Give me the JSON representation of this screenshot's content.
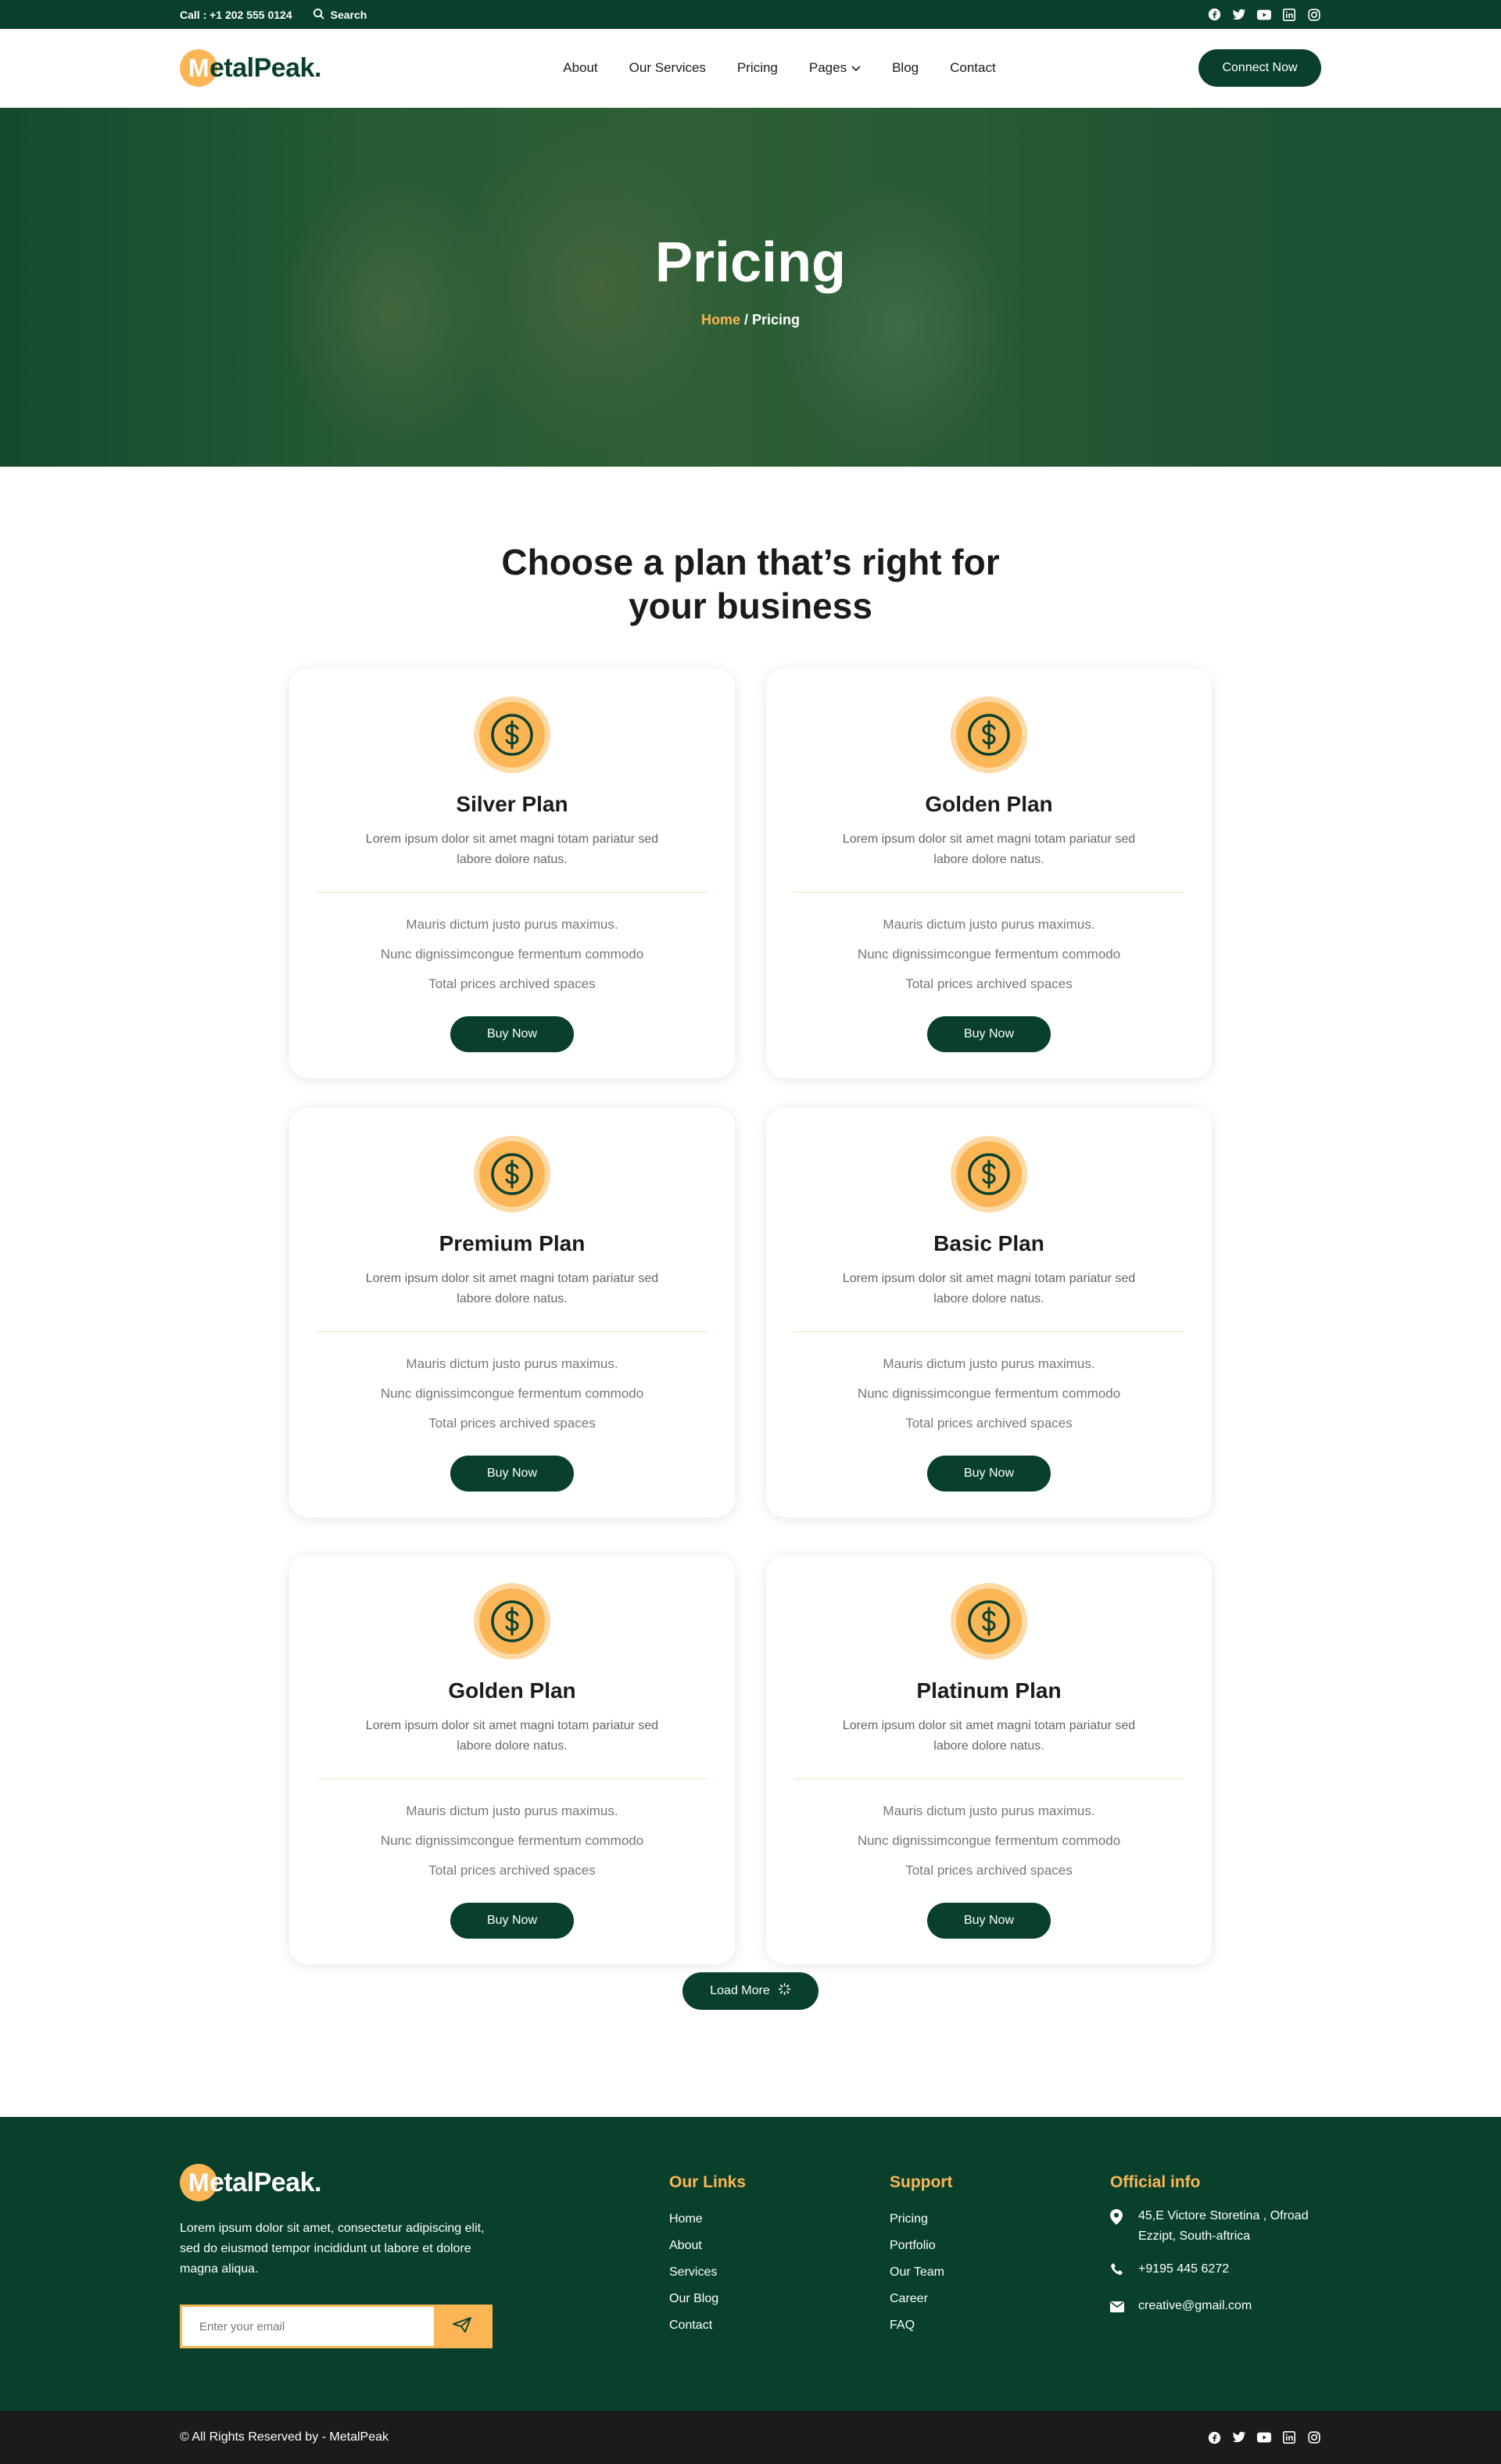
{
  "topbar": {
    "call": "Call : +1 202 555 0124",
    "search_label": "Search",
    "social": [
      "facebook-icon",
      "twitter-icon",
      "youtube-icon",
      "linkedin-icon",
      "instagram-icon"
    ]
  },
  "header": {
    "logo_initial": "M",
    "logo_rest": "etalPeak.",
    "nav": [
      {
        "label": "About"
      },
      {
        "label": "Our Services"
      },
      {
        "label": "Pricing"
      },
      {
        "label": "Pages"
      },
      {
        "label": "Blog"
      },
      {
        "label": "Contact"
      }
    ],
    "cta": "Connect Now"
  },
  "hero": {
    "title": "Pricing",
    "breadcrumb_home": "Home",
    "breadcrumb_sep": " / ",
    "breadcrumb_current": "Pricing"
  },
  "pricing": {
    "title": "Choose a plan that’s right for your business",
    "plans": [
      {
        "name": "Silver Plan",
        "desc": "Lorem ipsum dolor sit amet magni totam pariatur sed labore dolore natus.",
        "features": [
          "Mauris dictum justo purus maximus.",
          "Nunc dignissimcongue fermentum commodo",
          "Total prices archived spaces"
        ],
        "button": "Buy Now"
      },
      {
        "name": "Golden Plan",
        "desc": "Lorem ipsum dolor sit amet magni totam pariatur sed labore dolore natus.",
        "features": [
          "Mauris dictum justo purus maximus.",
          "Nunc dignissimcongue fermentum commodo",
          "Total prices archived spaces"
        ],
        "button": "Buy Now"
      },
      {
        "name": "Premium Plan",
        "desc": "Lorem ipsum dolor sit amet magni totam pariatur sed labore dolore natus.",
        "features": [
          "Mauris dictum justo purus maximus.",
          "Nunc dignissimcongue fermentum commodo",
          "Total prices archived spaces"
        ],
        "button": "Buy Now"
      },
      {
        "name": "Basic Plan",
        "desc": "Lorem ipsum dolor sit amet magni totam pariatur sed labore dolore natus.",
        "features": [
          "Mauris dictum justo purus maximus.",
          "Nunc dignissimcongue fermentum commodo",
          "Total prices archived spaces"
        ],
        "button": "Buy Now"
      },
      {
        "name": "Golden Plan",
        "desc": "Lorem ipsum dolor sit amet magni totam pariatur sed labore dolore natus.",
        "features": [
          "Mauris dictum justo purus maximus.",
          "Nunc dignissimcongue fermentum commodo",
          "Total prices archived spaces"
        ],
        "button": "Buy Now"
      },
      {
        "name": "Platinum Plan",
        "desc": "Lorem ipsum dolor sit amet magni totam pariatur sed labore dolore natus.",
        "features": [
          "Mauris dictum justo purus maximus.",
          "Nunc dignissimcongue fermentum commodo",
          "Total prices archived spaces"
        ],
        "button": "Buy Now"
      }
    ],
    "load_more": "Load More"
  },
  "footer": {
    "about": "Lorem ipsum dolor sit amet, consectetur adipiscing elit, sed do eiusmod tempor incididunt ut labore et dolore magna aliqua.",
    "email_placeholder": "Enter your email",
    "links_title": "Our Links",
    "links": [
      "Home",
      "About",
      "Services",
      "Our Blog",
      "Contact"
    ],
    "support_title": "Support",
    "support": [
      "Pricing",
      "Portfolio",
      "Our Team",
      "Career",
      "FAQ"
    ],
    "info_title": "Official info",
    "address": "45,E Victore Storetina , Ofroad Ezzipt, South-aftrica",
    "phone": "+9195 445 6272",
    "email": "creative@gmail.com",
    "copyright": "© All Rights Reserved by - MetalPeak"
  },
  "colors": {
    "brand_green": "#08402c",
    "accent_orange": "#fcb554",
    "dark": "#1b1b1b"
  }
}
